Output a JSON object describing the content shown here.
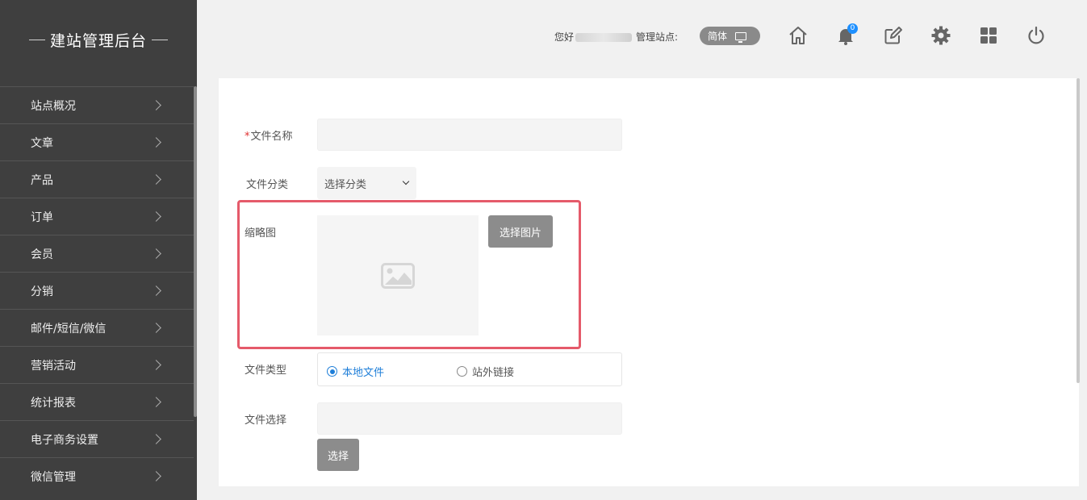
{
  "sidebar": {
    "title": "建站管理后台",
    "items": [
      {
        "label": "站点概况"
      },
      {
        "label": "文章"
      },
      {
        "label": "产品"
      },
      {
        "label": "订单"
      },
      {
        "label": "会员"
      },
      {
        "label": "分销"
      },
      {
        "label": "邮件/短信/微信"
      },
      {
        "label": "营销活动"
      },
      {
        "label": "统计报表"
      },
      {
        "label": "电子商务设置"
      },
      {
        "label": "微信管理"
      }
    ]
  },
  "header": {
    "greeting": "您好",
    "site_label": "管理站点:",
    "language": "简体",
    "notification_count": "0",
    "icons": [
      "home-icon",
      "bell-icon",
      "edit-icon",
      "gear-icon",
      "grid-icon",
      "power-icon"
    ]
  },
  "form": {
    "file_name_required_mark": "*",
    "file_name_label": "文件名称",
    "file_name_value": "",
    "category_label": "文件分类",
    "category_selected": "选择分类",
    "thumbnail_label": "缩略图",
    "choose_image_button": "选择图片",
    "file_type_label": "文件类型",
    "file_type_options": [
      {
        "label": "本地文件",
        "selected": true
      },
      {
        "label": "站外链接",
        "selected": false
      }
    ],
    "file_select_label": "文件选择",
    "file_select_value": "",
    "choose_button": "选择"
  },
  "colors": {
    "sidebar_bg": "#3f3f3f",
    "highlight_border": "#e55a6a",
    "accent_blue": "#1e7ed8",
    "button_gray": "#8c8c8c"
  }
}
